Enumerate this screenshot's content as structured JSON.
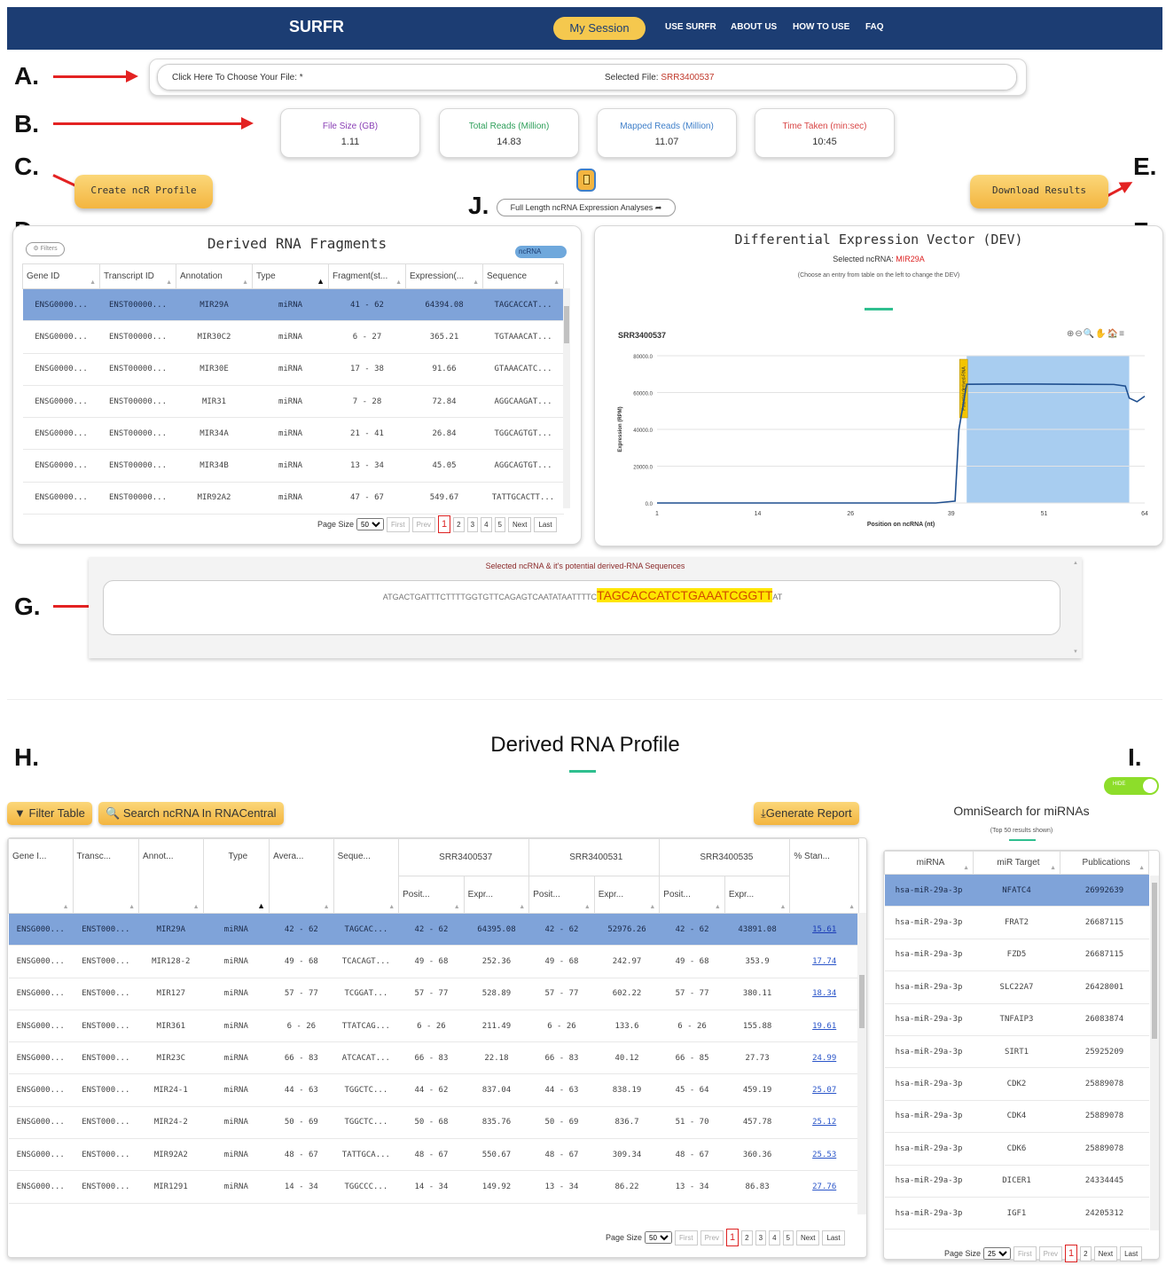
{
  "nav": {
    "brand": "SURFR",
    "my_session": "My Session",
    "links": [
      "USE SURFR",
      "ABOUT US",
      "HOW TO USE",
      "FAQ"
    ]
  },
  "annotations": [
    "A.",
    "B.",
    "C.",
    "D.",
    "E.",
    "F.",
    "G.",
    "H.",
    "I.",
    "J."
  ],
  "file": {
    "choose_label": "Click Here To Choose Your File: *",
    "selected_prefix": "Selected File: ",
    "selected_file": "SRR3400537"
  },
  "stats": [
    {
      "label": "File Size (GB)",
      "value": "1.11",
      "color": "#8a3fb5"
    },
    {
      "label": "Total Reads (Million)",
      "value": "14.83",
      "color": "#2e9f5a"
    },
    {
      "label": "Mapped Reads (Million)",
      "value": "11.07",
      "color": "#3f7fc9"
    },
    {
      "label": "Time Taken (min:sec)",
      "value": "10:45",
      "color": "#d84545"
    }
  ],
  "buttons": {
    "create_profile": "Create ncR Profile",
    "download_results": "Download Results",
    "full_length": "Full Length ncRNA Expression Analyses"
  },
  "fragments": {
    "title": "Derived RNA Fragments",
    "filters": "Filters",
    "toggle": "ncRNA",
    "columns": [
      "Gene ID",
      "Transcript ID",
      "Annotation",
      "Type",
      "Fragment(st...",
      "Expression(...",
      "Sequence"
    ],
    "rows": [
      [
        "ENSG0000...",
        "ENST00000...",
        "MIR29A",
        "miRNA",
        "41 - 62",
        "64394.08",
        "TAGCACCAT..."
      ],
      [
        "ENSG0000...",
        "ENST00000...",
        "MIR30C2",
        "miRNA",
        "6 - 27",
        "365.21",
        "TGTAAACAT..."
      ],
      [
        "ENSG0000...",
        "ENST00000...",
        "MIR30E",
        "miRNA",
        "17 - 38",
        "91.66",
        "GTAAACATC..."
      ],
      [
        "ENSG0000...",
        "ENST00000...",
        "MIR31",
        "miRNA",
        "7 - 28",
        "72.84",
        "AGGCAAGAT..."
      ],
      [
        "ENSG0000...",
        "ENST00000...",
        "MIR34A",
        "miRNA",
        "21 - 41",
        "26.84",
        "TGGCAGTGT..."
      ],
      [
        "ENSG0000...",
        "ENST00000...",
        "MIR34B",
        "miRNA",
        "13 - 34",
        "45.05",
        "AGGCAGTGT..."
      ],
      [
        "ENSG0000...",
        "ENST00000...",
        "MIR92A2",
        "miRNA",
        "47 - 67",
        "549.67",
        "TATTGCACTT..."
      ]
    ],
    "page_size_label": "Page Size",
    "page_size": "50",
    "pager": {
      "first": "First",
      "prev": "Prev",
      "pages": [
        "1",
        "2",
        "3",
        "4",
        "5"
      ],
      "next": "Next",
      "last": "Last"
    }
  },
  "dev": {
    "title": "Differential Expression Vector (DEV)",
    "selected_label": "Selected ncRNA: ",
    "selected_value": "MIR29A",
    "hint": "(Choose an entry from table on the left to change the DEV)",
    "sample": "SRR3400537",
    "toolbar_icons": "⊕⊖🔍✋🏠≡",
    "potential_label": "Potential derived-RNA",
    "chart_data": {
      "type": "line",
      "title": "SRR3400537",
      "xlabel": "Position on ncRNA (nt)",
      "ylabel": "Expression (RPM)",
      "x_ticks": [
        "1",
        "14",
        "26",
        "39",
        "51",
        "64"
      ],
      "y_ticks": [
        "0.0",
        "20000.0",
        "40000.0",
        "60000.0",
        "80000.0"
      ],
      "ylim": [
        0,
        80000
      ],
      "xlim": [
        1,
        64
      ],
      "highlight_range": [
        41,
        62
      ],
      "series": [
        {
          "x": [
            1,
            10,
            20,
            30,
            37,
            39.5,
            40,
            41,
            45,
            50,
            55,
            60,
            61.5,
            62,
            63,
            64
          ],
          "values": [
            0,
            0,
            0,
            0,
            0,
            1000,
            40000,
            64500,
            64600,
            64600,
            64500,
            64400,
            63500,
            57000,
            55000,
            58000
          ]
        }
      ]
    }
  },
  "sequence": {
    "title": "Selected ncRNA & it's potential derived-RNA Sequences",
    "prefix": "ATGACTGATTTCTTTTGGTGTTCAGAGTCAATATAATTTTC",
    "highlight": "TAGCACCATCTGAAATCGGTT",
    "suffix": "AT"
  },
  "profile": {
    "title": "Derived RNA Profile",
    "filter_btn": "Filter Table",
    "search_btn": "Search ncRNA In RNACentral",
    "report_btn": "Generate Report",
    "columns": [
      "Gene I...",
      "Transc...",
      "Annot...",
      "Type",
      "Avera...",
      "Seque..."
    ],
    "samples": [
      "SRR3400537",
      "SRR3400531",
      "SRR3400535"
    ],
    "sub_columns": [
      "Posit...",
      "Expr..."
    ],
    "last_col": "% Stan...",
    "rows": [
      [
        "ENSG000...",
        "ENST000...",
        "MIR29A",
        "miRNA",
        "42 - 62",
        "TAGCAC...",
        "42 - 62",
        "64395.08",
        "42 - 62",
        "52976.26",
        "42 - 62",
        "43891.08",
        "15.61"
      ],
      [
        "ENSG000...",
        "ENST000...",
        "MIR128-2",
        "miRNA",
        "49 - 68",
        "TCACAGT...",
        "49 - 68",
        "252.36",
        "49 - 68",
        "242.97",
        "49 - 68",
        "353.9",
        "17.74"
      ],
      [
        "ENSG000...",
        "ENST000...",
        "MIR127",
        "miRNA",
        "57 - 77",
        "TCGGAT...",
        "57 - 77",
        "528.89",
        "57 - 77",
        "602.22",
        "57 - 77",
        "380.11",
        "18.34"
      ],
      [
        "ENSG000...",
        "ENST000...",
        "MIR361",
        "miRNA",
        "6 - 26",
        "TTATCAG...",
        "6 - 26",
        "211.49",
        "6 - 26",
        "133.6",
        "6 - 26",
        "155.88",
        "19.61"
      ],
      [
        "ENSG000...",
        "ENST000...",
        "MIR23C",
        "miRNA",
        "66 - 83",
        "ATCACAT...",
        "66 - 83",
        "22.18",
        "66 - 83",
        "40.12",
        "66 - 85",
        "27.73",
        "24.99"
      ],
      [
        "ENSG000...",
        "ENST000...",
        "MIR24-1",
        "miRNA",
        "44 - 63",
        "TGGCTC...",
        "44 - 62",
        "837.04",
        "44 - 63",
        "838.19",
        "45 - 64",
        "459.19",
        "25.07"
      ],
      [
        "ENSG000...",
        "ENST000...",
        "MIR24-2",
        "miRNA",
        "50 - 69",
        "TGGCTC...",
        "50 - 68",
        "835.76",
        "50 - 69",
        "836.7",
        "51 - 70",
        "457.78",
        "25.12"
      ],
      [
        "ENSG000...",
        "ENST000...",
        "MIR92A2",
        "miRNA",
        "48 - 67",
        "TATTGCA...",
        "48 - 67",
        "550.67",
        "48 - 67",
        "309.34",
        "48 - 67",
        "360.36",
        "25.53"
      ],
      [
        "ENSG000...",
        "ENST000...",
        "MIR1291",
        "miRNA",
        "14 - 34",
        "TGGCCC...",
        "14 - 34",
        "149.92",
        "13 - 34",
        "86.22",
        "13 - 34",
        "86.83",
        "27.76"
      ]
    ],
    "page_size_label": "Page Size",
    "page_size": "50",
    "pager": {
      "first": "First",
      "prev": "Prev",
      "pages": [
        "1",
        "2",
        "3",
        "4",
        "5"
      ],
      "next": "Next",
      "last": "Last"
    }
  },
  "omni": {
    "toggle_label": "HIDE",
    "title": "OmniSearch for miRNAs",
    "subtitle": "(Top 50 results shown)",
    "columns": [
      "miRNA",
      "miR Target",
      "Publications"
    ],
    "rows": [
      [
        "hsa-miR-29a-3p",
        "NFATC4",
        "26992639"
      ],
      [
        "hsa-miR-29a-3p",
        "FRAT2",
        "26687115"
      ],
      [
        "hsa-miR-29a-3p",
        "FZD5",
        "26687115"
      ],
      [
        "hsa-miR-29a-3p",
        "SLC22A7",
        "26428001"
      ],
      [
        "hsa-miR-29a-3p",
        "TNFAIP3",
        "26083874"
      ],
      [
        "hsa-miR-29a-3p",
        "SIRT1",
        "25925209"
      ],
      [
        "hsa-miR-29a-3p",
        "CDK2",
        "25889078"
      ],
      [
        "hsa-miR-29a-3p",
        "CDK4",
        "25889078"
      ],
      [
        "hsa-miR-29a-3p",
        "CDK6",
        "25889078"
      ],
      [
        "hsa-miR-29a-3p",
        "DICER1",
        "24334445"
      ],
      [
        "hsa-miR-29a-3p",
        "IGF1",
        "24205312"
      ]
    ],
    "page_size_label": "Page Size",
    "page_size": "25",
    "pager": {
      "first": "First",
      "prev": "Prev",
      "pages": [
        "1",
        "2"
      ],
      "next": "Next",
      "last": "Last"
    }
  }
}
